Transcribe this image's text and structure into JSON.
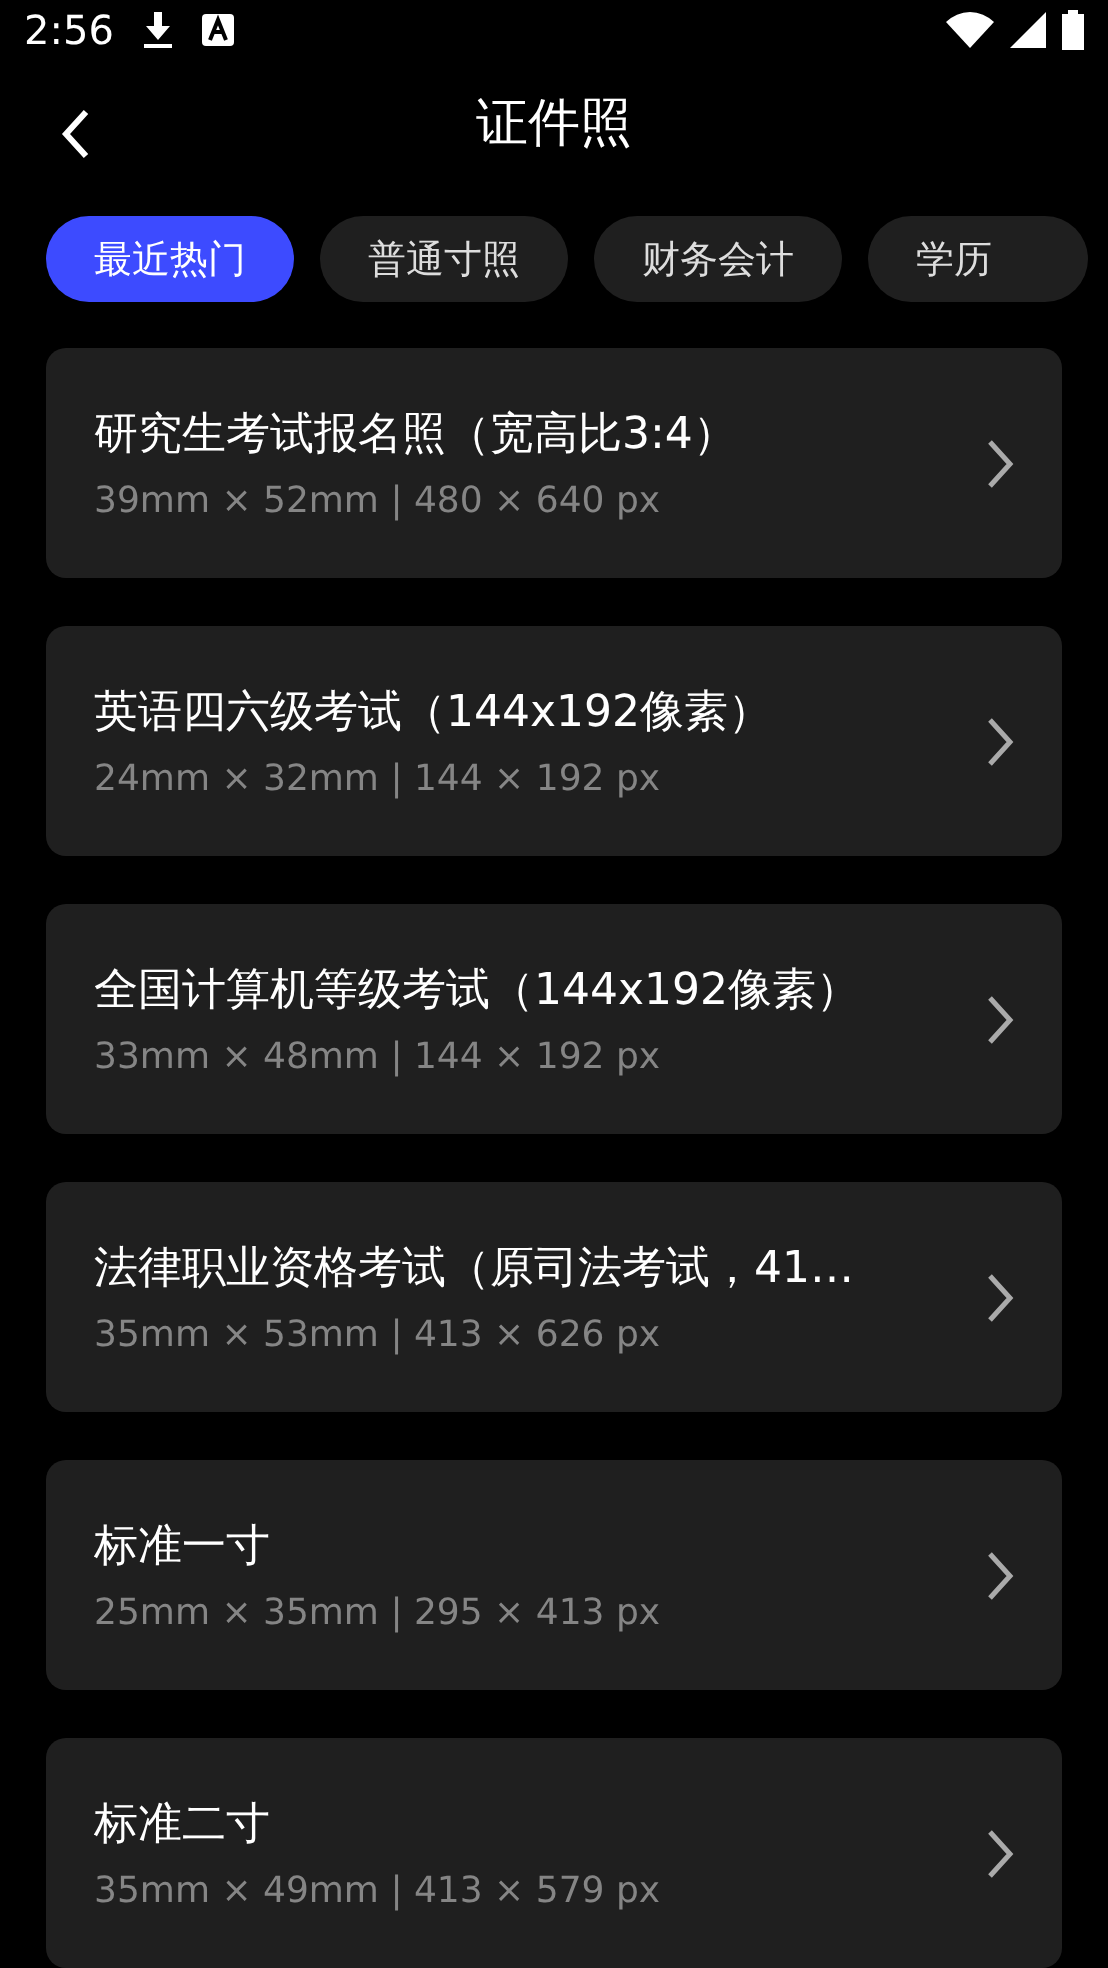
{
  "status_bar": {
    "time": "2:56"
  },
  "header": {
    "title": "证件照"
  },
  "tabs": [
    {
      "label": "最近热门",
      "selected": true
    },
    {
      "label": "普通寸照",
      "selected": false
    },
    {
      "label": "财务会计",
      "selected": false
    },
    {
      "label": "学历",
      "selected": false
    }
  ],
  "items": [
    {
      "title": "研究生考试报名照（宽高比3:4）",
      "size": "39mm × 52mm | 480 × 640 px"
    },
    {
      "title": "英语四六级考试（144x192像素）",
      "size": "24mm × 32mm | 144 × 192 px"
    },
    {
      "title": "全国计算机等级考试（144x192像素）",
      "size": "33mm × 48mm | 144 × 192 px"
    },
    {
      "title": "法律职业资格考试（原司法考试，41…",
      "size": "35mm × 53mm | 413 × 626 px"
    },
    {
      "title": "标准一寸",
      "size": "25mm × 35mm | 295 × 413 px"
    },
    {
      "title": "标准二寸",
      "size": "35mm × 49mm | 413 × 579 px"
    }
  ]
}
